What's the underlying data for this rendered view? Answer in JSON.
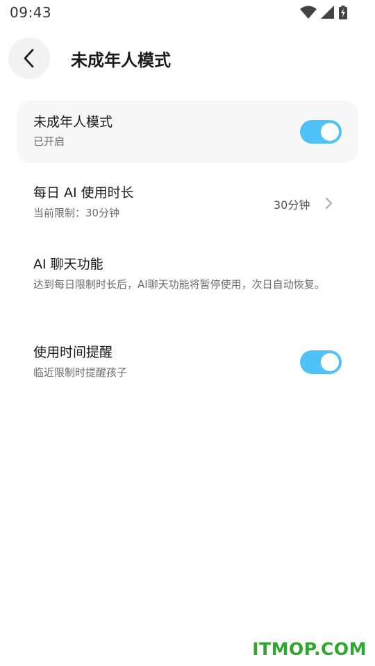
{
  "status_bar": {
    "time": "09:43"
  },
  "header": {
    "title": "未成年人模式"
  },
  "minor_mode": {
    "title": "未成年人模式",
    "status": "已开启",
    "enabled": true
  },
  "daily_ai": {
    "title": "每日 AI 使用时长",
    "subtitle": "当前限制：30分钟",
    "value": "30分钟"
  },
  "ai_chat": {
    "title": "AI 聊天功能",
    "description": "达到每日限制时长后，AI聊天功能将暂停使用，次日自动恢复。"
  },
  "usage_reminder": {
    "title": "使用时间提醒",
    "subtitle": "临近限制时提醒孩子",
    "enabled": true
  },
  "watermark": {
    "text": "ITMOP.COM"
  },
  "colors": {
    "accent": "#4fc3f7",
    "card_bg": "#f7f7f7",
    "watermark": "#2fa62f"
  }
}
